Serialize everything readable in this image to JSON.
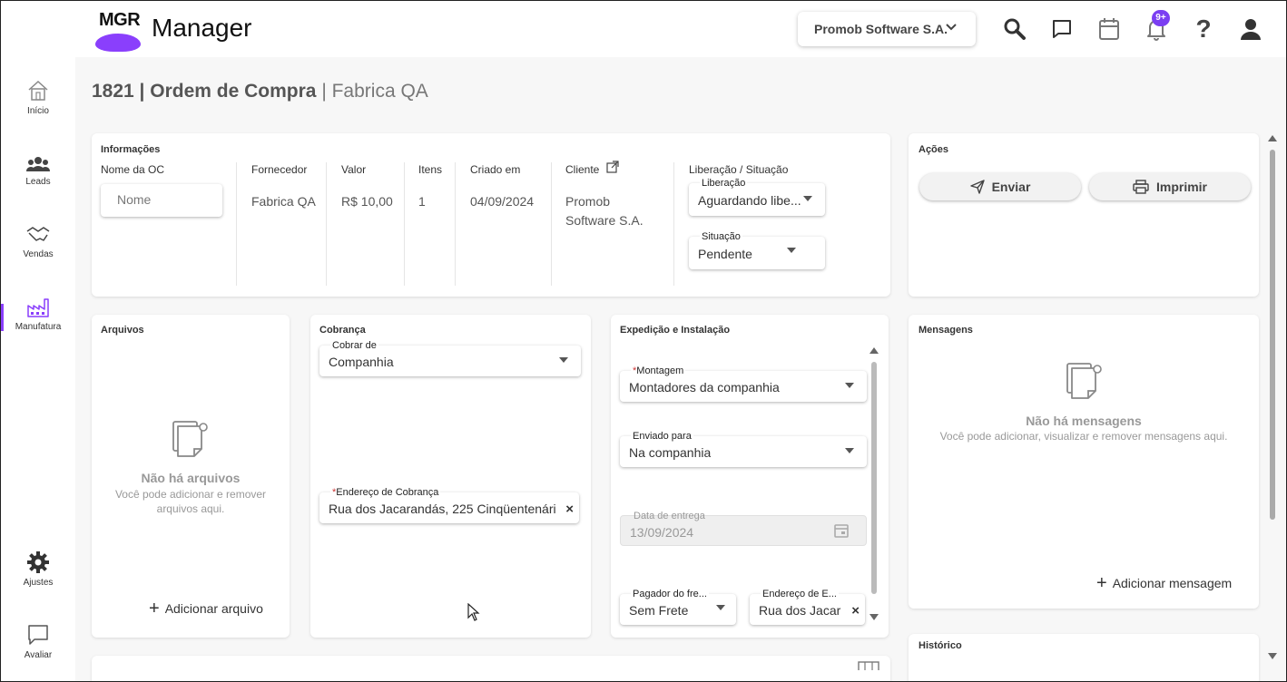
{
  "header": {
    "logo_text": "MGR",
    "app_name": "Manager",
    "company": "Promob Software S.A.",
    "notifications_badge": "9+",
    "help_label": "?"
  },
  "sidebar": {
    "items": [
      {
        "label": "Início",
        "icon": "home-icon"
      },
      {
        "label": "Leads",
        "icon": "users-icon"
      },
      {
        "label": "Vendas",
        "icon": "handshake-icon"
      },
      {
        "label": "Manufatura",
        "icon": "factory-icon"
      },
      {
        "label": "Ajustes",
        "icon": "gear-icon"
      },
      {
        "label": "Avaliar",
        "icon": "chat-icon"
      }
    ]
  },
  "page": {
    "title": "1821 | Ordem de Compra",
    "subtitle": "| Fabrica QA"
  },
  "info": {
    "title": "Informações",
    "name_label": "Nome da OC",
    "name_placeholder": "Nome",
    "supplier_label": "Fornecedor",
    "supplier_value": "Fabrica QA",
    "value_label": "Valor",
    "value_value": "R$ 10,00",
    "items_label": "Itens",
    "items_value": "1",
    "created_label": "Criado em",
    "created_value": "04/09/2024",
    "client_label": "Cliente",
    "client_value_1": "Promob",
    "client_value_2": "Software S.A.",
    "status_label": "Liberação / Situação",
    "release_label": "Liberação",
    "release_value": "Aguardando libe...",
    "situation_label": "Situação",
    "situation_value": "Pendente"
  },
  "actions": {
    "title": "Ações",
    "send": "Enviar",
    "print": "Imprimir"
  },
  "files": {
    "title": "Arquivos",
    "empty_title": "Não há arquivos",
    "empty_desc_1": "Você pode adicionar e remover",
    "empty_desc_2": "arquivos aqui.",
    "add": "Adicionar arquivo"
  },
  "billing": {
    "title": "Cobrança",
    "charge_label": "Cobrar de",
    "charge_value": "Companhia",
    "address_label": "Endereço de Cobrança",
    "address_value": "Rua dos Jacarandás, 225 Cinqüentenário"
  },
  "shipping": {
    "title": "Expedição e Instalação",
    "assembly_label": "Montagem",
    "assembly_value": "Montadores da companhia",
    "sent_label": "Enviado para",
    "sent_value": "Na companhia",
    "date_label": "Data de entrega",
    "date_value": "13/09/2024",
    "payer_label": "Pagador do fre...",
    "payer_value": "Sem Frete",
    "ship_addr_label": "Endereço de E...",
    "ship_addr_value": "Rua dos Jacar"
  },
  "messages": {
    "title": "Mensagens",
    "empty_title": "Não há mensagens",
    "empty_desc": "Você pode adicionar, visualizar e remover mensagens aqui.",
    "add": "Adicionar mensagem"
  },
  "history": {
    "title": "Histórico"
  },
  "colors": {
    "accent": "#8a3ffc",
    "badge": "#7b3ff2"
  }
}
